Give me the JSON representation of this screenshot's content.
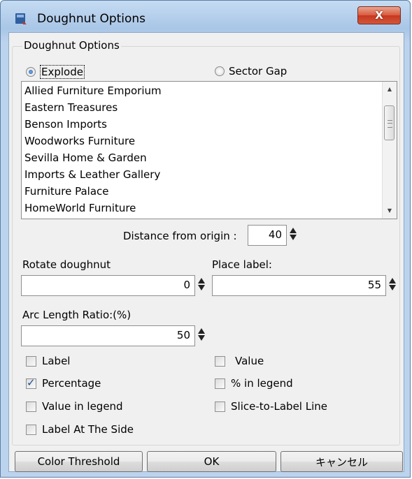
{
  "window": {
    "title": "Doughnut Options",
    "close_label": "X"
  },
  "group": {
    "label": "Doughnut Options"
  },
  "radios": {
    "explode": "Explode",
    "sector_gap": "Sector Gap",
    "selected": "Explode"
  },
  "list": {
    "items": [
      "Allied Furniture Emporium",
      "Eastern Treasures",
      "Benson Imports",
      "Woodworks Furniture",
      "Sevilla Home & Garden",
      "Imports & Leather Gallery",
      "Furniture Palace",
      "HomeWorld Furniture"
    ]
  },
  "distance": {
    "label": "Distance from origin :",
    "value": "40"
  },
  "rotate": {
    "label": "Rotate doughnut",
    "value": "0"
  },
  "place_label": {
    "label": "Place label:",
    "value": "55"
  },
  "arc": {
    "label": "Arc Length Ratio:(%)",
    "value": "50"
  },
  "checkboxes": {
    "label": {
      "text": "Label",
      "checked": false
    },
    "value": {
      "text": "Value",
      "checked": false
    },
    "percentage": {
      "text": "Percentage",
      "checked": true
    },
    "pct_in_legend": {
      "text": "% in legend",
      "checked": false
    },
    "value_in_legend": {
      "text": "Value in legend",
      "checked": false
    },
    "slice_to_label": {
      "text": "Slice-to-Label Line",
      "checked": false
    },
    "label_at_side": {
      "text": "Label At The Side",
      "checked": false
    }
  },
  "buttons": {
    "color_threshold": "Color Threshold",
    "ok": "OK",
    "cancel": "キャンセル"
  },
  "colors": {
    "title_bar": "#a9c6e7",
    "close_button": "#c7381f",
    "client_bg": "#f0f0f0",
    "check_mark": "#1e4d9c"
  }
}
